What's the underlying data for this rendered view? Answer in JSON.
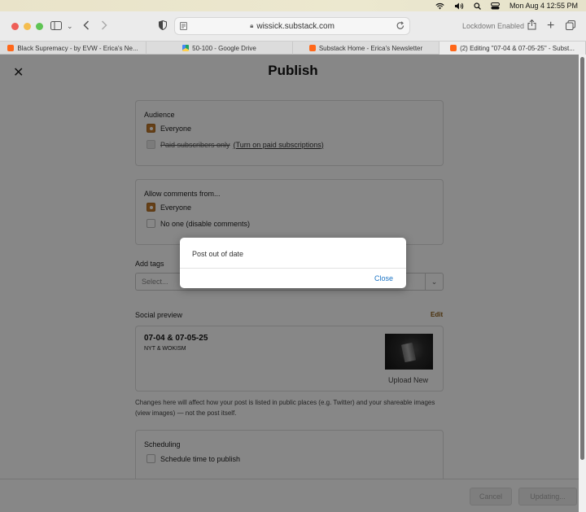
{
  "menubar": {
    "date_time": "Mon Aug 4  12:55 PM"
  },
  "browser": {
    "url": "wissick.substack.com",
    "lockdown": "Lockdown Enabled",
    "tabs": [
      {
        "label": "Black Supremacy - by EVW - Erica's Ne...",
        "icon": "substack-icon"
      },
      {
        "label": "50-100 - Google Drive",
        "icon": "google-drive-icon"
      },
      {
        "label": "Substack Home - Erica's Newsletter",
        "icon": "substack-icon"
      },
      {
        "label": "(2) Editing \"07-04 & 07-05-25\" - Subst...",
        "icon": "substack-icon"
      }
    ]
  },
  "page": {
    "title": "Publish",
    "audience": {
      "label": "Audience",
      "everyone": "Everyone",
      "paid_only": "Paid subscribers only",
      "paid_link": "(Turn on paid subscriptions)"
    },
    "comments": {
      "label": "Allow comments from...",
      "everyone": "Everyone",
      "none": "No one (disable comments)"
    },
    "tags": {
      "label": "Add tags",
      "placeholder": "Select..."
    },
    "social_preview": {
      "label": "Social preview",
      "edit": "Edit",
      "title": "07-04 & 07-05-25",
      "subtitle": "NYT & WOKISM",
      "upload": "Upload New",
      "note": "Changes here will affect how your post is listed in public places (e.g. Twitter) and your shareable images (view images) — not the post itself."
    },
    "scheduling": {
      "label": "Scheduling",
      "option": "Schedule time to publish"
    },
    "footer": {
      "cancel": "Cancel",
      "updating": "Updating..."
    }
  },
  "dialog": {
    "message": "Post out of date",
    "close": "Close"
  },
  "colors": {
    "accent": "#c07a2c",
    "link": "#1a73c4",
    "substack": "#ff6719"
  }
}
